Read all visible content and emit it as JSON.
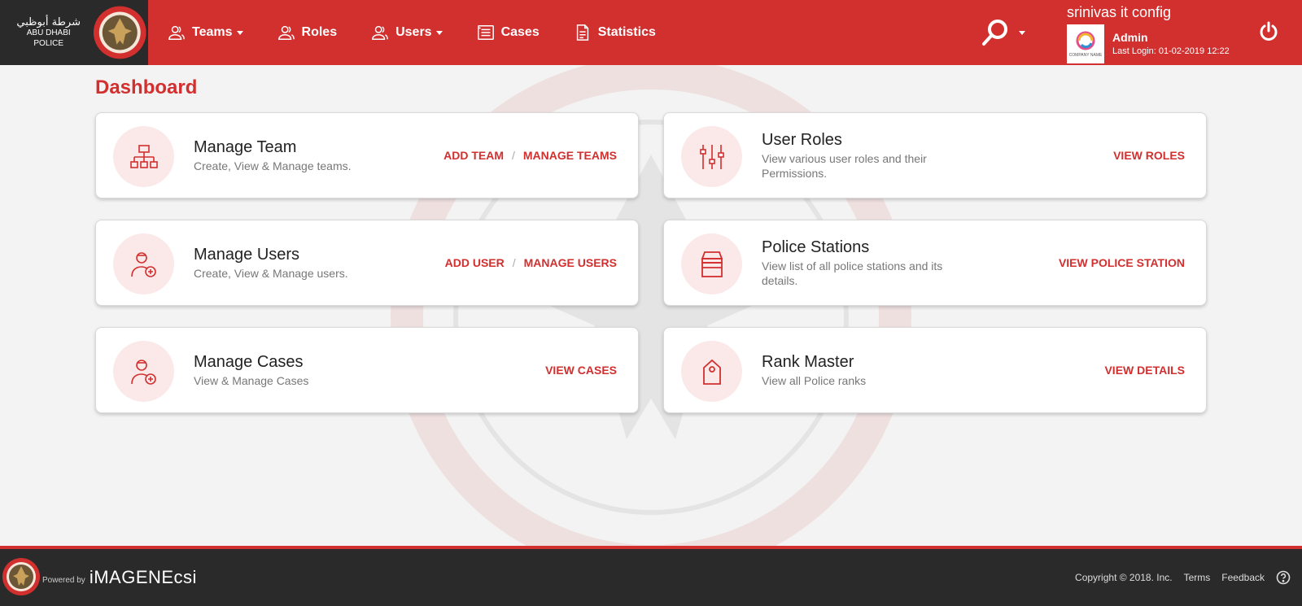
{
  "brand": {
    "arabic": "شرطة أبوظبي",
    "english": "ABU DHABI POLICE"
  },
  "nav": {
    "teams": "Teams",
    "roles": "Roles",
    "users": "Users",
    "cases": "Cases",
    "statistics": "Statistics"
  },
  "user": {
    "org": "srinivas it config",
    "company_logo_text": "COMPANY NAME",
    "name": "Admin",
    "last_login": "Last Login: 01-02-2019 12:22"
  },
  "page_title": "Dashboard",
  "cards": {
    "team": {
      "title": "Manage Team",
      "desc": "Create, View & Manage teams.",
      "action1": "ADD TEAM",
      "action2": "MANAGE TEAMS"
    },
    "roles": {
      "title": "User Roles",
      "desc": "View various user roles and their Permissions.",
      "action1": "VIEW ROLES"
    },
    "users": {
      "title": "Manage Users",
      "desc": "Create, View & Manage users.",
      "action1": "ADD USER",
      "action2": "MANAGE USERS"
    },
    "stations": {
      "title": "Police Stations",
      "desc": "View list of all police stations and its details.",
      "action1": "VIEW POLICE STATION"
    },
    "cases": {
      "title": "Manage Cases",
      "desc": "View & Manage Cases",
      "action1": "VIEW CASES"
    },
    "ranks": {
      "title": "Rank Master",
      "desc": "View all Police ranks",
      "action1": "VIEW DETAILS"
    }
  },
  "separator": "/",
  "footer": {
    "powered_by": "Powered by",
    "powered_brand": "iMAGENEcsi",
    "copyright": "Copyright © 2018. Inc.",
    "terms": "Terms",
    "feedback": "Feedback"
  },
  "colors": {
    "primary": "#d22f2f",
    "dark": "#2a2a2a",
    "icon_bg": "#fbe9e9"
  }
}
